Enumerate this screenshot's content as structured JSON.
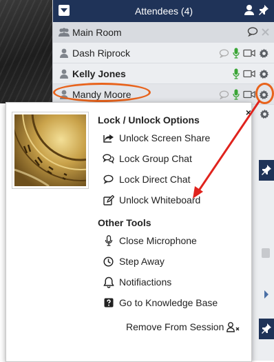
{
  "panel": {
    "title": "Attendees (4)",
    "rows": [
      {
        "name": "Main Room"
      },
      {
        "name": "Dash Riprock"
      },
      {
        "name": "Kelly Jones"
      },
      {
        "name": "Mandy Moore"
      }
    ]
  },
  "popup": {
    "lock_title": "Lock / Unlock Options",
    "lock_items": [
      {
        "label": "Unlock Screen Share",
        "icon": "share-icon"
      },
      {
        "label": "Lock Group Chat",
        "icon": "group-chat-icon"
      },
      {
        "label": "Lock Direct Chat",
        "icon": "chat-icon"
      },
      {
        "label": "Unlock Whiteboard",
        "icon": "edit-icon"
      }
    ],
    "other_title": "Other Tools",
    "other_items": [
      {
        "label": "Close Microphone",
        "icon": "microphone-icon"
      },
      {
        "label": "Step Away",
        "icon": "clock-icon"
      },
      {
        "label": "Notifiactions",
        "icon": "bell-icon"
      },
      {
        "label": "Go to Knowledge Base",
        "icon": "question-icon"
      }
    ],
    "remove_label": "Remove From Session",
    "close_glyph": "×"
  },
  "colors": {
    "header": "#1f3358",
    "highlight": "#e8631c",
    "annotation_arrow": "#e0231d",
    "mic_active": "#3aa536"
  }
}
